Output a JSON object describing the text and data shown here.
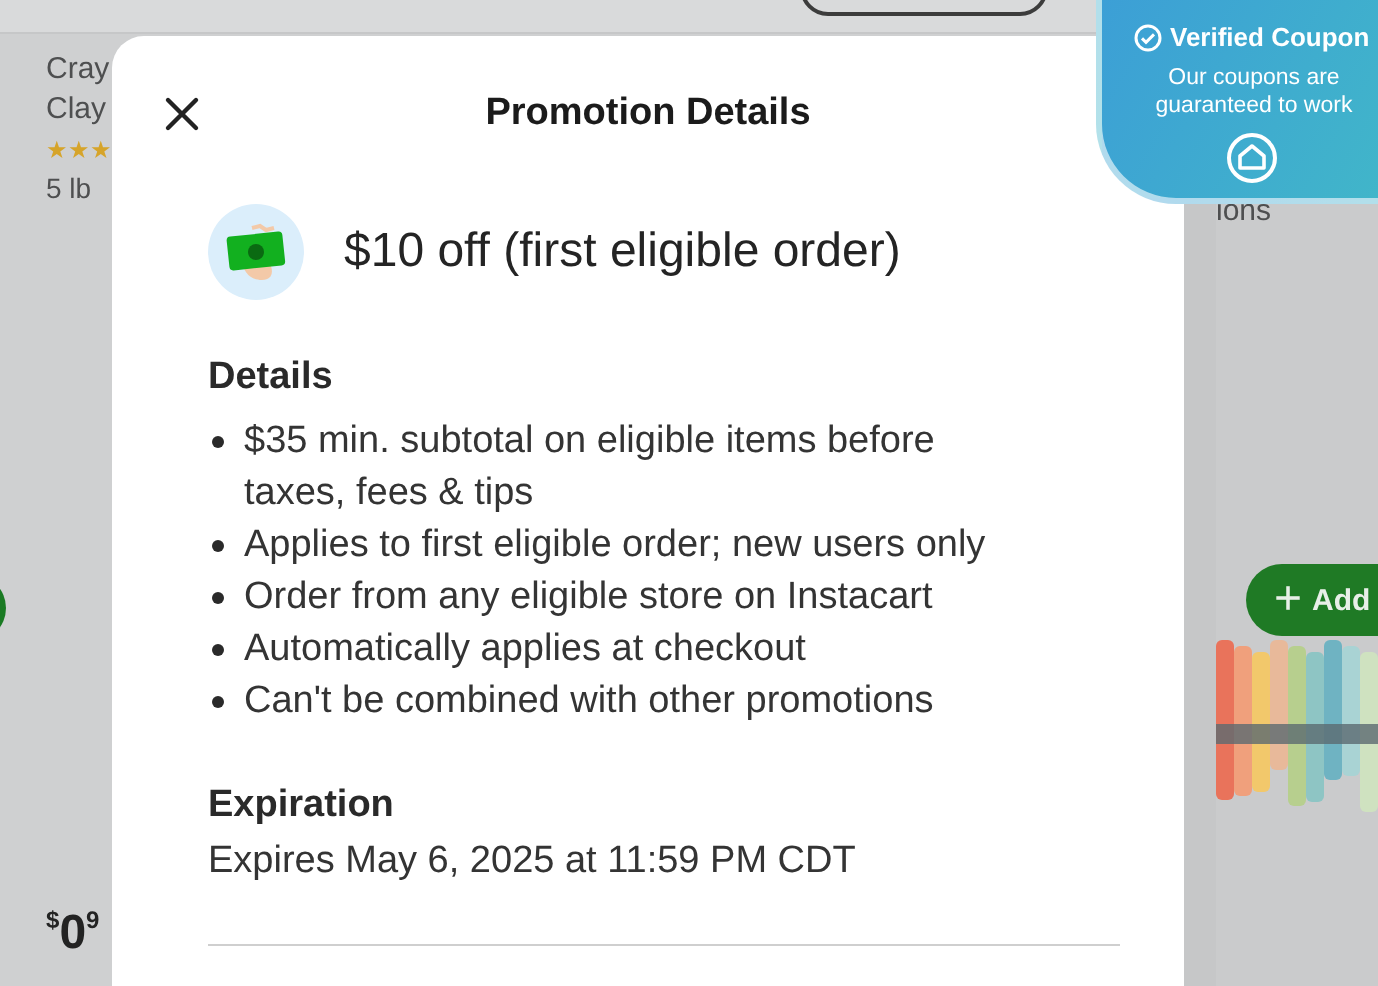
{
  "background": {
    "left_card": {
      "title_lines": [
        "Cray",
        "Clay"
      ],
      "stars": 3,
      "size": "5 lb",
      "price": {
        "currency": "$",
        "whole": "0",
        "cents": "9"
      }
    },
    "right_card": {
      "subtitle": "ions",
      "add_button": {
        "icon": "+",
        "label": "Add"
      }
    }
  },
  "modal": {
    "title": "Promotion Details",
    "headline": "$10 off (first eligible order)",
    "sections": [
      {
        "heading": "Details",
        "kind": "list",
        "items": [
          "$35 min. subtotal on eligible items before taxes, fees & tips",
          "Applies to first eligible order; new users only",
          "Order from any eligible store on Instacart",
          "Automatically applies at checkout",
          "Can't be combined with other promotions"
        ]
      },
      {
        "heading": "Expiration",
        "kind": "text",
        "text": "Expires May 6, 2025 at 11:59 PM CDT"
      }
    ]
  },
  "coupon_badge": {
    "title": "Verified Coupon",
    "text": "Our coupons are guaranteed to work"
  }
}
